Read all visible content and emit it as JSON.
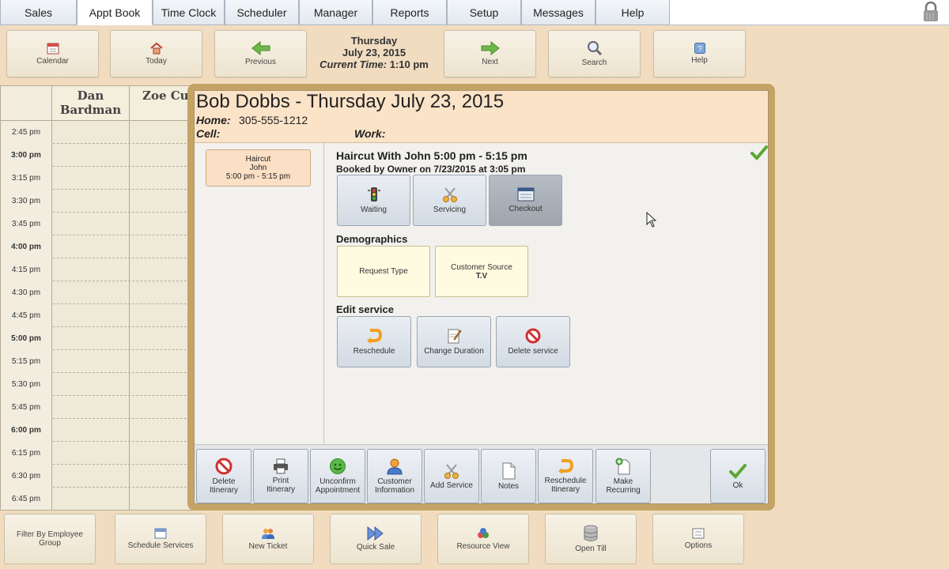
{
  "nav": {
    "tabs": [
      {
        "label": "Sales"
      },
      {
        "label": "Appt Book"
      },
      {
        "label": "Time Clock"
      },
      {
        "label": "Scheduler"
      },
      {
        "label": "Manager"
      },
      {
        "label": "Reports"
      },
      {
        "label": "Setup"
      },
      {
        "label": "Messages"
      },
      {
        "label": "Help"
      }
    ],
    "active_tab": "Appt Book"
  },
  "toolbar": {
    "calendar": "Calendar",
    "today": "Today",
    "previous": "Previous",
    "next": "Next",
    "search": "Search",
    "help": "Help",
    "date": {
      "weekday": "Thursday",
      "date": "July 23, 2015",
      "current_time_label": "Current Time:",
      "current_time": "1:10 pm"
    }
  },
  "schedule": {
    "columns": [
      "Dan Bardman",
      "Zoe Cut"
    ],
    "times": [
      {
        "t": "2:45 pm",
        "bold": false
      },
      {
        "t": "3:00 pm",
        "bold": true
      },
      {
        "t": "3:15 pm",
        "bold": false
      },
      {
        "t": "3:30 pm",
        "bold": false
      },
      {
        "t": "3:45 pm",
        "bold": false
      },
      {
        "t": "4:00 pm",
        "bold": true
      },
      {
        "t": "4:15 pm",
        "bold": false
      },
      {
        "t": "4:30 pm",
        "bold": false
      },
      {
        "t": "4:45 pm",
        "bold": false
      },
      {
        "t": "5:00 pm",
        "bold": true
      },
      {
        "t": "5:15 pm",
        "bold": false
      },
      {
        "t": "5:30 pm",
        "bold": false
      },
      {
        "t": "5:45 pm",
        "bold": false
      },
      {
        "t": "6:00 pm",
        "bold": true
      },
      {
        "t": "6:15 pm",
        "bold": false
      },
      {
        "t": "6:30 pm",
        "bold": false
      },
      {
        "t": "6:45 pm",
        "bold": false
      }
    ]
  },
  "dialog": {
    "title": "Bob Dobbs - Thursday July 23, 2015",
    "home_label": "Home:",
    "home_value": "305-555-1212",
    "cell_label": "Cell:",
    "cell_value": "",
    "work_label": "Work:",
    "work_value": "",
    "appointment_card": {
      "service": "Haircut",
      "employee": "John",
      "time": "5:00 pm - 5:15 pm"
    },
    "service_title": "Haircut With John 5:00 pm - 5:15 pm",
    "booked_by": "Booked by Owner on 7/23/2015 at 3:05 pm",
    "status_buttons": {
      "waiting": "Waiting",
      "servicing": "Servicing",
      "checkout": "Checkout"
    },
    "demographics_heading": "Demographics",
    "request_type": "Request Type",
    "customer_source_label": "Customer Source",
    "customer_source_value": "T.V",
    "edit_service_heading": "Edit service",
    "edit_buttons": {
      "reschedule": "Reschedule",
      "change_duration": "Change Duration",
      "delete_service": "Delete service"
    },
    "actions": {
      "delete_itinerary": [
        "Delete",
        "Itinerary"
      ],
      "print_itinerary": [
        "Print",
        "Itinerary"
      ],
      "unconfirm_appointment": [
        "Unconfirm",
        "Appointment"
      ],
      "customer_information": [
        "Customer",
        "Information"
      ],
      "add_service": "Add Service",
      "notes": "Notes",
      "reschedule_itinerary": [
        "Reschedule",
        "Itinerary"
      ],
      "make_recurring": [
        "Make",
        "Recurring"
      ],
      "ok": "Ok"
    }
  },
  "footer": {
    "filter_by_employee_group": [
      "Filter By Employee",
      "Group"
    ],
    "schedule_services": "Schedule Services",
    "new_ticket": "New Ticket",
    "quick_sale": "Quick Sale",
    "resource_view": "Resource View",
    "open_till": "Open Till",
    "options": "Options"
  },
  "colors": {
    "background": "#f1dcc0",
    "dialog_frame": "#c4a466",
    "dialog_header": "#fbe3c8",
    "green_check": "#5aa832"
  }
}
